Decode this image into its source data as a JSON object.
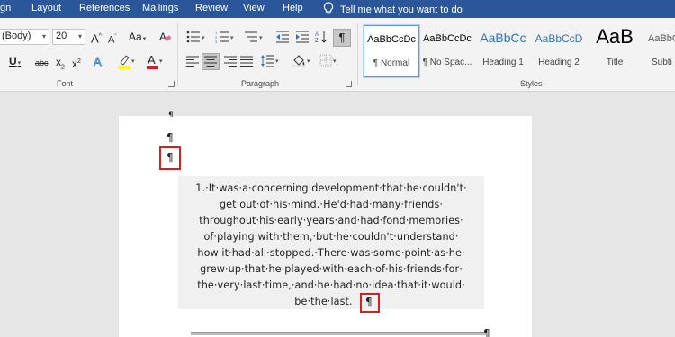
{
  "menu": {
    "tabs": [
      "gn",
      "Layout",
      "References",
      "Mailings",
      "Review",
      "View",
      "Help"
    ],
    "tell_me": "Tell me what you want to do"
  },
  "ribbon": {
    "font": {
      "font_name": "(Body)",
      "font_size": "20",
      "group_label": "Font",
      "grow_label": "A",
      "shrink_label": "A",
      "case_label": "Aa",
      "underline": "U",
      "strike": "abc",
      "subscript": "x",
      "subscript_digit": "2",
      "superscript": "x",
      "superscript_digit": "2",
      "font_color_label": "A",
      "font_color": "#e81123",
      "highlight_color": "#ffff00"
    },
    "paragraph": {
      "group_label": "Paragraph",
      "show_marks": "¶"
    },
    "styles": {
      "group_label": "Styles",
      "items": [
        {
          "preview": "AaBbCcDc",
          "name": "¶ Normal"
        },
        {
          "preview": "AaBbCcDc",
          "name": "¶ No Spac..."
        },
        {
          "preview": "AaBbCc",
          "name": "Heading 1"
        },
        {
          "preview": "AaBbCcD",
          "name": "Heading 2"
        },
        {
          "preview": "AaB",
          "name": "Title"
        },
        {
          "preview": "AaBbCcD",
          "name": "Subti"
        }
      ]
    }
  },
  "document": {
    "marks": {
      "top_partial": "¶",
      "empty_para": "¶",
      "highlighted_para": "¶",
      "end_mark": "¶",
      "bottom_mark": "¶"
    },
    "paragraph_lines": [
      "1.·It·was·a·concerning·development·that·he·couldn't·",
      "get·out·of·his·mind.·He'd·had·many·friends·",
      "throughout·his·early·years·and·had·fond·memories·",
      "of·playing·with·them,·but·he·couldn't·understand·",
      "how·it·had·all·stopped.·There·was·some·point·as·he·",
      "grew·up·that·he·played·with·each·of·his·friends·for·",
      "the·very·last·time,·and·he·had·no·idea·that·it·would·",
      "be·the·last."
    ]
  },
  "colors": {
    "title_bar": "#2b579a",
    "highlight_box": "#d0231f"
  }
}
